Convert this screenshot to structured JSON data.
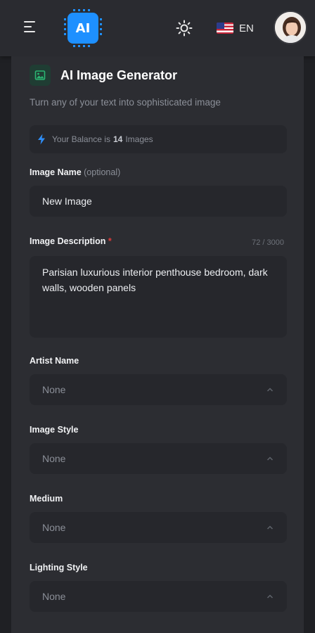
{
  "header": {
    "logo_text": "AI",
    "language": "EN"
  },
  "generator": {
    "title": "AI Image Generator",
    "subtitle": "Turn any of your text into sophisticated image",
    "balance_prefix": "Your Balance is",
    "balance_count": "14",
    "balance_suffix": "Images"
  },
  "form": {
    "image_name": {
      "label": "Image Name",
      "optional": "(optional)",
      "value": "New Image"
    },
    "image_description": {
      "label": "Image Description",
      "required_mark": "*",
      "counter": "72 / 3000",
      "value": "Parisian luxurious interior penthouse bedroom, dark walls, wooden panels"
    },
    "artist_name": {
      "label": "Artist Name",
      "value": "None"
    },
    "image_style": {
      "label": "Image Style",
      "value": "None"
    },
    "medium": {
      "label": "Medium",
      "value": "None"
    },
    "lighting_style": {
      "label": "Lighting Style",
      "value": "None"
    }
  },
  "icons": {
    "menu": "menu-icon",
    "theme": "sun-icon",
    "flag": "us-flag-icon",
    "image": "image-icon",
    "balance": "lightning-icon",
    "dropdown": "chevron-up-icon"
  },
  "colors": {
    "background": "#1f2024",
    "card": "#2c2d32",
    "field": "#26272c",
    "accent_blue": "#1e90ff",
    "accent_green": "#2bb673",
    "required_red": "#e03b3b"
  }
}
